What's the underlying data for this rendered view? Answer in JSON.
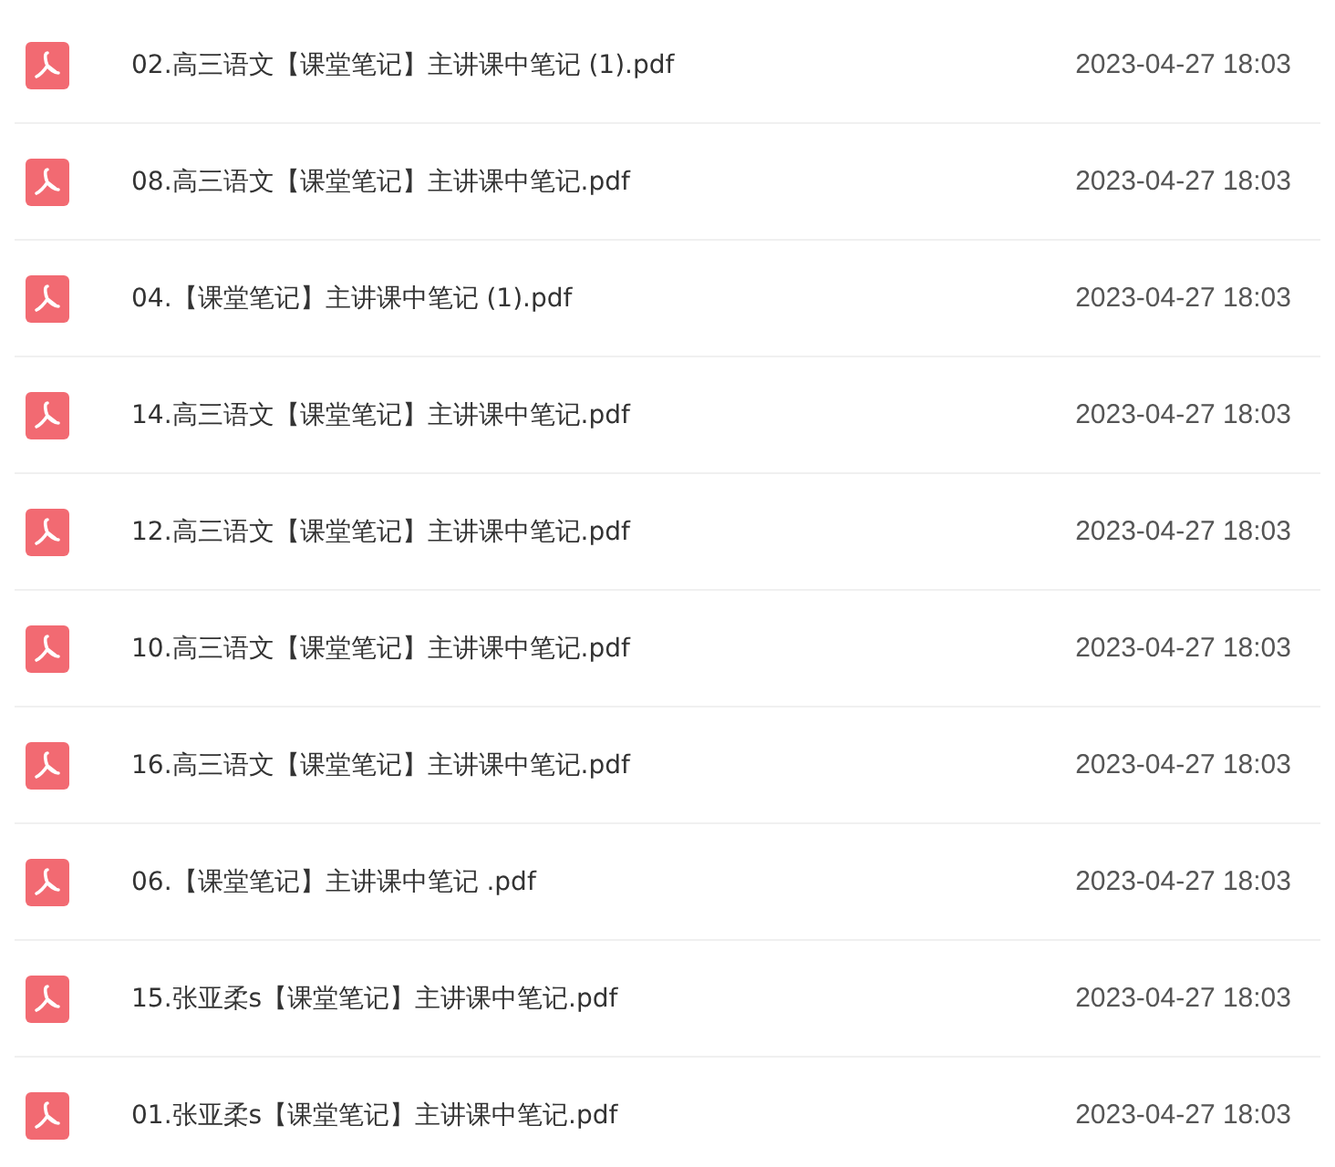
{
  "files": [
    {
      "name": "02.高三语文【课堂笔记】主讲课中笔记 (1).pdf",
      "date": "2023-04-27 18:03"
    },
    {
      "name": "08.高三语文【课堂笔记】主讲课中笔记.pdf",
      "date": "2023-04-27 18:03"
    },
    {
      "name": "04.【课堂笔记】主讲课中笔记 (1).pdf",
      "date": "2023-04-27 18:03"
    },
    {
      "name": "14.高三语文【课堂笔记】主讲课中笔记.pdf",
      "date": "2023-04-27 18:03"
    },
    {
      "name": "12.高三语文【课堂笔记】主讲课中笔记.pdf",
      "date": "2023-04-27 18:03"
    },
    {
      "name": "10.高三语文【课堂笔记】主讲课中笔记.pdf",
      "date": "2023-04-27 18:03"
    },
    {
      "name": "16.高三语文【课堂笔记】主讲课中笔记.pdf",
      "date": "2023-04-27 18:03"
    },
    {
      "name": "06.【课堂笔记】主讲课中笔记 .pdf",
      "date": "2023-04-27 18:03"
    },
    {
      "name": "15.张亚柔s【课堂笔记】主讲课中笔记.pdf",
      "date": "2023-04-27 18:03"
    },
    {
      "name": "01.张亚柔s【课堂笔记】主讲课中笔记.pdf",
      "date": "2023-04-27 18:03"
    }
  ]
}
